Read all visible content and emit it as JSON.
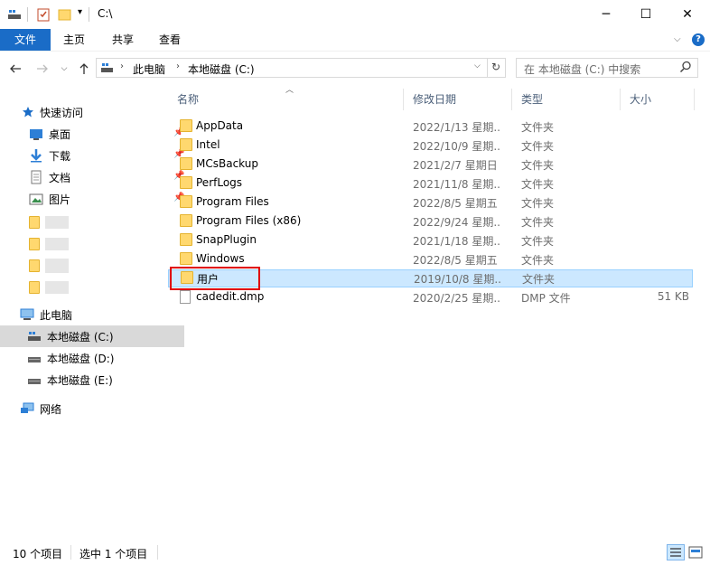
{
  "window": {
    "title": "C:\\",
    "minimize": "─",
    "maximize": "☐",
    "close": "✕"
  },
  "ribbon": {
    "file": "文件",
    "home": "主页",
    "share": "共享",
    "view": "查看",
    "help": "?"
  },
  "address": {
    "crumbs": [
      "此电脑",
      "本地磁盘 (C:)"
    ],
    "search_placeholder": "在 本地磁盘 (C:) 中搜索"
  },
  "sidebar": {
    "quick_access": "快速访问",
    "quick_items": [
      {
        "label": "桌面"
      },
      {
        "label": "下载"
      },
      {
        "label": "文档"
      },
      {
        "label": "图片"
      }
    ],
    "this_pc": "此电脑",
    "drives": [
      {
        "label": "本地磁盘 (C:)"
      },
      {
        "label": "本地磁盘 (D:)"
      },
      {
        "label": "本地磁盘 (E:)"
      }
    ],
    "network": "网络"
  },
  "columns": {
    "name": "名称",
    "date": "修改日期",
    "type": "类型",
    "size": "大小"
  },
  "files": [
    {
      "name": "AppData",
      "date": "2022/1/13 星期...",
      "type": "文件夹",
      "size": ""
    },
    {
      "name": "Intel",
      "date": "2022/10/9 星期...",
      "type": "文件夹",
      "size": ""
    },
    {
      "name": "MCsBackup",
      "date": "2021/2/7 星期日 ...",
      "type": "文件夹",
      "size": ""
    },
    {
      "name": "PerfLogs",
      "date": "2021/11/8 星期...",
      "type": "文件夹",
      "size": ""
    },
    {
      "name": "Program Files",
      "date": "2022/8/5 星期五 ...",
      "type": "文件夹",
      "size": ""
    },
    {
      "name": "Program Files (x86)",
      "date": "2022/9/24 星期...",
      "type": "文件夹",
      "size": ""
    },
    {
      "name": "SnapPlugin",
      "date": "2021/1/18 星期...",
      "type": "文件夹",
      "size": ""
    },
    {
      "name": "Windows",
      "date": "2022/8/5 星期五 ...",
      "type": "文件夹",
      "size": ""
    },
    {
      "name": "用户",
      "date": "2019/10/8 星期...",
      "type": "文件夹",
      "size": ""
    },
    {
      "name": "cadedit.dmp",
      "date": "2020/2/25 星期...",
      "type": "DMP 文件",
      "size": "51 KB"
    }
  ],
  "status": {
    "count": "10 个项目",
    "selected": "选中 1 个项目"
  },
  "colors": {
    "accent": "#1a6cc7",
    "selection": "#cce8ff",
    "highlight_box": "#e00000",
    "folder": "#ffd86f"
  }
}
